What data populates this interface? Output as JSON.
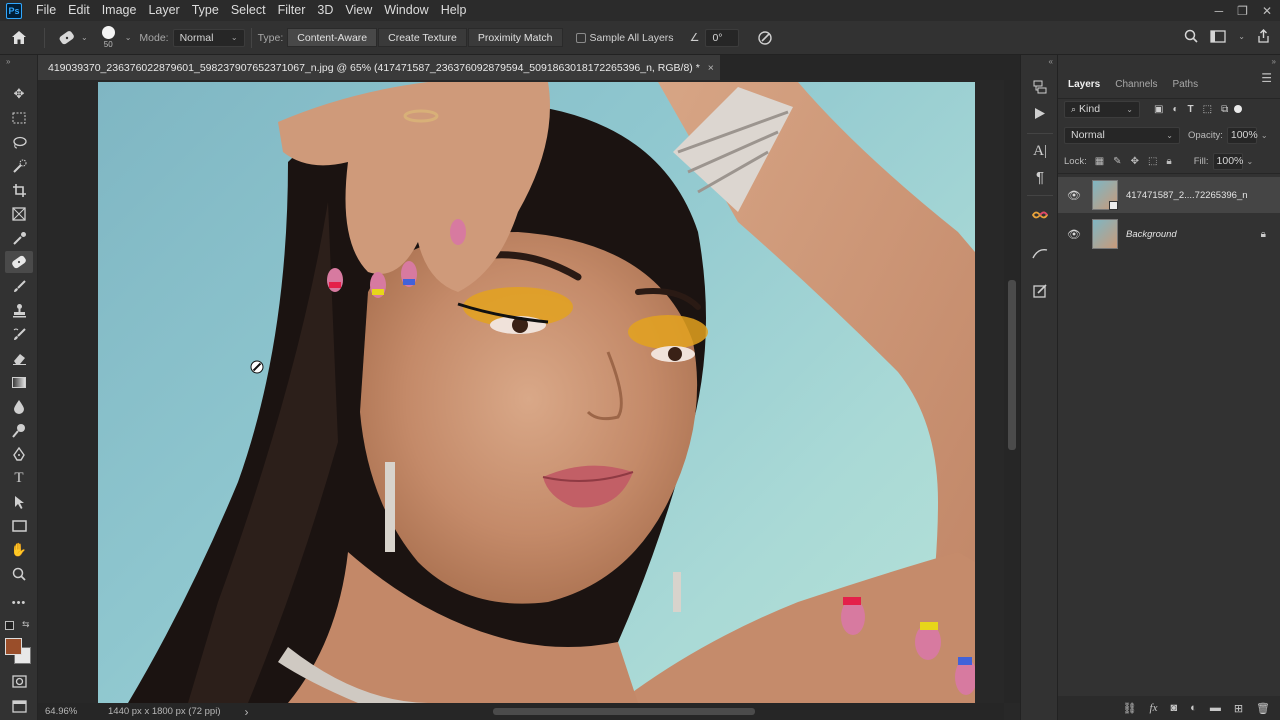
{
  "menu": [
    "File",
    "Edit",
    "Image",
    "Layer",
    "Type",
    "Select",
    "Filter",
    "3D",
    "View",
    "Window",
    "Help"
  ],
  "app": {
    "logo": "Ps"
  },
  "options": {
    "brush_size": "50",
    "mode_label": "Mode:",
    "mode_value": "Normal",
    "type_label": "Type:",
    "type_buttons": [
      "Content-Aware",
      "Create Texture",
      "Proximity Match"
    ],
    "sample_all_layers": "Sample All Layers",
    "angle_value": "0°"
  },
  "document": {
    "tab_title": "419039370_236376022879601_598237907652371067_n.jpg @ 65% (417471587_236376092879594_5091863018172265396_n, RGB/8) *",
    "close": "×"
  },
  "status": {
    "zoom": "64.96%",
    "dimensions": "1440 px x 1800 px (72 ppi)",
    "arrow": "›"
  },
  "layers_panel": {
    "tabs": [
      "Layers",
      "Channels",
      "Paths"
    ],
    "filter_kind": "Kind",
    "blend_mode": "Normal",
    "opacity_label": "Opacity:",
    "opacity_value": "100%",
    "lock_label": "Lock:",
    "fill_label": "Fill:",
    "fill_value": "100%",
    "layers": [
      {
        "name": "417471587_2....72265396_n",
        "selected": true
      },
      {
        "name": "Background",
        "selected": false,
        "locked": true
      }
    ],
    "footer_fx": "fx"
  },
  "colors": {
    "foreground": "#9a4e2a",
    "background": "#e8e8e8",
    "accent": "#31a8ff",
    "photo_bg": "#8fc7cf"
  }
}
